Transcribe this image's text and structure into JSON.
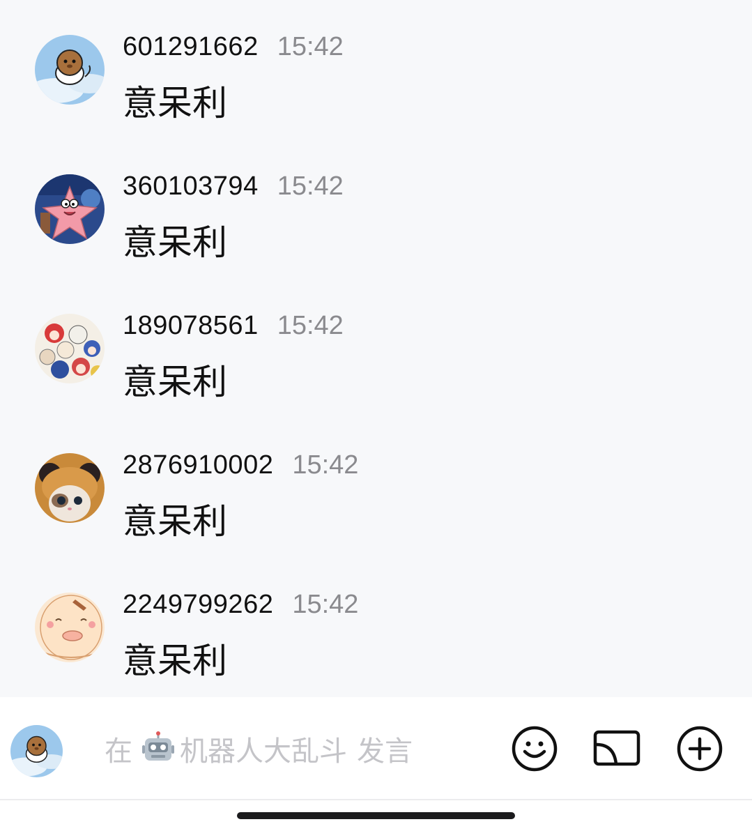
{
  "messages": [
    {
      "sender": "601291662",
      "time": "15:42",
      "text": "意呆利",
      "avatar_icon": "hamster-cloud-avatar"
    },
    {
      "sender": "360103794",
      "time": "15:42",
      "text": "意呆利",
      "avatar_icon": "patrick-star-avatar"
    },
    {
      "sender": "189078561",
      "time": "15:42",
      "text": "意呆利",
      "avatar_icon": "anime-crowd-avatar"
    },
    {
      "sender": "2876910002",
      "time": "15:42",
      "text": "意呆利",
      "avatar_icon": "cat-hood-avatar"
    },
    {
      "sender": "2249799262",
      "time": "15:42",
      "text": "意呆利",
      "avatar_icon": "cartoon-face-avatar"
    }
  ],
  "composer": {
    "placeholder_prefix": "在",
    "placeholder_channel": "机器人大乱斗",
    "placeholder_suffix": "发言",
    "emoji_icon": "smiley-icon",
    "cast_icon": "cast-icon",
    "add_icon": "plus-circle-icon"
  },
  "colors": {
    "chat_background": "#f7f8fa",
    "composer_background": "#ffffff",
    "placeholder": "#c4c4c8",
    "time": "#8a8a8e"
  }
}
